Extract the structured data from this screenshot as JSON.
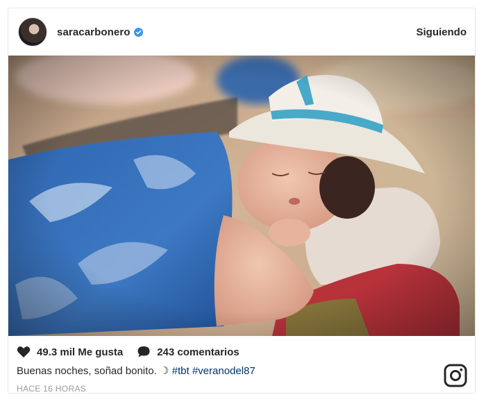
{
  "post": {
    "username": "saracarbonero",
    "verified_icon": "verified-badge-icon",
    "follow_label": "Siguiendo",
    "likes": "49.3 mil Me gusta",
    "comments": "243 comentarios",
    "caption_text": "Buenas noches, soñad bonito.",
    "caption_emoji": "☽",
    "hashtags": [
      "#tbt",
      "#veranodel87"
    ],
    "timestamp": "HACE 16 HORAS",
    "icons": {
      "like": "heart-icon",
      "comment": "comment-bubble-icon",
      "brand": "instagram-logo-icon"
    },
    "colors": {
      "verified": "#3897f0",
      "hashtag": "#003569",
      "text": "#262626",
      "muted": "#999999"
    }
  }
}
